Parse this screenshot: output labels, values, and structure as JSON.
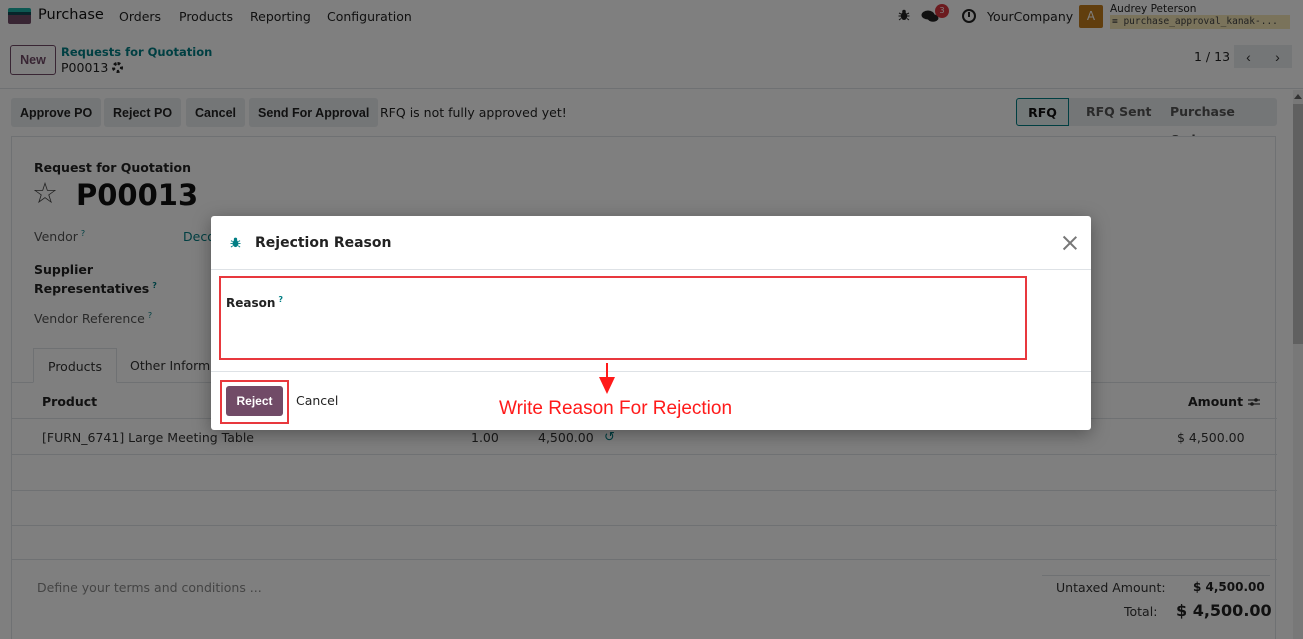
{
  "topbar": {
    "app_name": "Purchase",
    "menu": [
      "Orders",
      "Products",
      "Reporting",
      "Configuration"
    ],
    "message_count": "3",
    "company": "YourCompany",
    "avatar_letter": "A",
    "user_name": "Audrey Peterson",
    "database": "purchase_approval_kanak-..."
  },
  "control_panel": {
    "new_label": "New",
    "breadcrumb_parent": "Requests for Quotation",
    "breadcrumb_current": "P00013",
    "pager": "1 / 13",
    "prev_label": "‹",
    "next_label": "›"
  },
  "status_bar": {
    "actions": [
      "Approve PO",
      "Reject PO",
      "Cancel",
      "Send For Approval"
    ],
    "note": "RFQ is not fully approved yet!",
    "stages": [
      "RFQ",
      "RFQ Sent",
      "Purchase Order"
    ],
    "active_stage": "RFQ"
  },
  "form": {
    "subtitle": "Request for Quotation",
    "title": "P00013",
    "fields": {
      "vendor_label": "Vendor",
      "vendor_value": "Deco",
      "supplier_reps_label_1": "Supplier",
      "supplier_reps_label_2": "Representatives",
      "vendor_ref_label": "Vendor Reference"
    },
    "help_mark": "?",
    "tabs": [
      "Products",
      "Other Informa"
    ],
    "table": {
      "headers": {
        "product": "Product",
        "amount": "Amount"
      },
      "rows": [
        {
          "product": "[FURN_6741] Large Meeting Table",
          "quantity": "1.00",
          "unit_price": "4,500.00",
          "amount": "$ 4,500.00"
        }
      ]
    },
    "terms_placeholder": "Define your terms and conditions ...",
    "totals": {
      "untaxed_label": "Untaxed Amount:",
      "untaxed_value": "$ 4,500.00",
      "total_label": "Total:",
      "total_value": "$ 4,500.00"
    }
  },
  "dialog": {
    "title": "Rejection Reason",
    "reason_label": "Reason",
    "reason_help": "?",
    "reason_value": "",
    "reject_label": "Reject",
    "cancel_label": "Cancel"
  },
  "annotation": {
    "text": "Write Reason For Rejection",
    "color": "#ff1a1a"
  },
  "colors": {
    "brand": "#714b67",
    "link": "#017e84",
    "highlight": "#e8383d"
  }
}
